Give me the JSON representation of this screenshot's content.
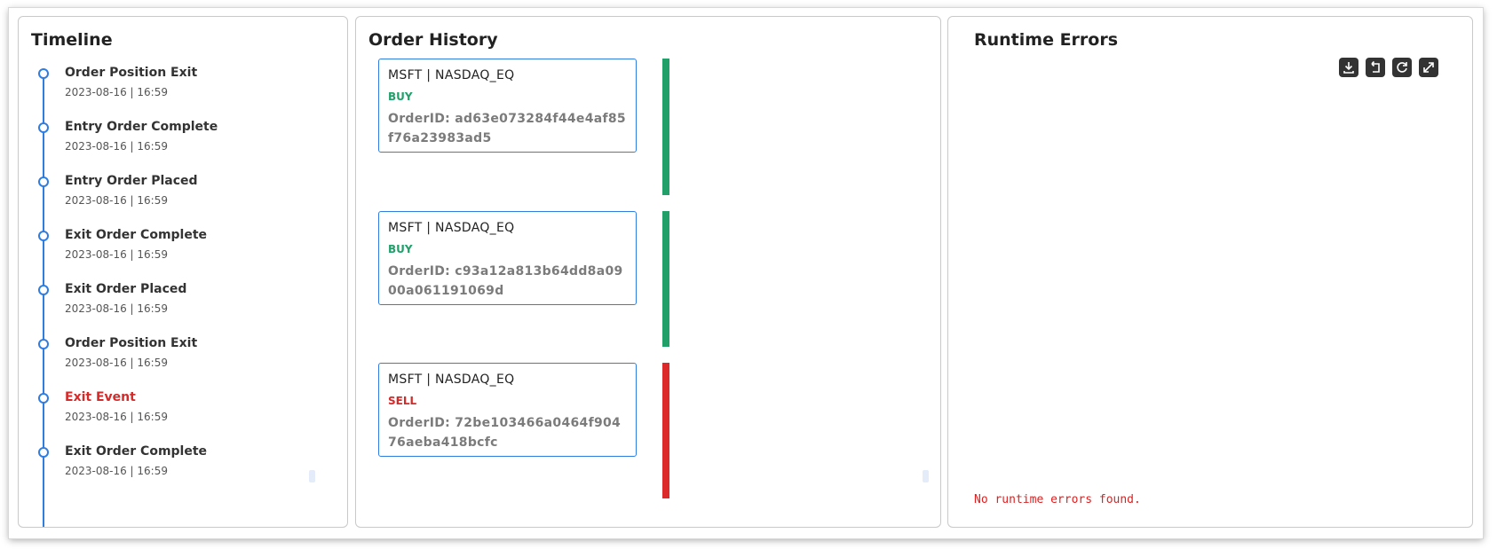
{
  "timeline": {
    "title": "Timeline",
    "items": [
      {
        "title": "Order Position Exit",
        "time": "2023-08-16 | 16:59",
        "highlight": false
      },
      {
        "title": "Entry Order Complete",
        "time": "2023-08-16 | 16:59",
        "highlight": false
      },
      {
        "title": "Entry Order Placed",
        "time": "2023-08-16 | 16:59",
        "highlight": false
      },
      {
        "title": "Exit Order Complete",
        "time": "2023-08-16 | 16:59",
        "highlight": false
      },
      {
        "title": "Exit Order Placed",
        "time": "2023-08-16 | 16:59",
        "highlight": false
      },
      {
        "title": "Order Position Exit",
        "time": "2023-08-16 | 16:59",
        "highlight": false
      },
      {
        "title": "Exit Event",
        "time": "2023-08-16 | 16:59",
        "highlight": true
      },
      {
        "title": "Exit Order Complete",
        "time": "2023-08-16 | 16:59",
        "highlight": false
      }
    ]
  },
  "orders": {
    "title": "Order History",
    "items": [
      {
        "symbol": "MSFT | NASDAQ_EQ",
        "side": "BUY",
        "order_id": "OrderID: ad63e073284f44e4af85f76a23983ad5",
        "bar_color": "#21a06a"
      },
      {
        "symbol": "MSFT | NASDAQ_EQ",
        "side": "BUY",
        "order_id": "OrderID: c93a12a813b64dd8a0900a061191069d",
        "bar_color": "#21a06a"
      },
      {
        "symbol": "MSFT | NASDAQ_EQ",
        "side": "SELL",
        "order_id": "OrderID: 72be103466a0464f90476aeba418bcfc",
        "bar_color": "#dc2a2a"
      }
    ]
  },
  "errors": {
    "title": "Runtime Errors",
    "message": "No runtime errors found.",
    "toolbar": {
      "icons": [
        "download-icon",
        "undo-icon",
        "refresh-icon",
        "expand-icon"
      ]
    }
  },
  "colors": {
    "accent": "#2f7de1",
    "buy": "#21a06a",
    "sell": "#d42a2a",
    "error_text": "#e02020"
  }
}
